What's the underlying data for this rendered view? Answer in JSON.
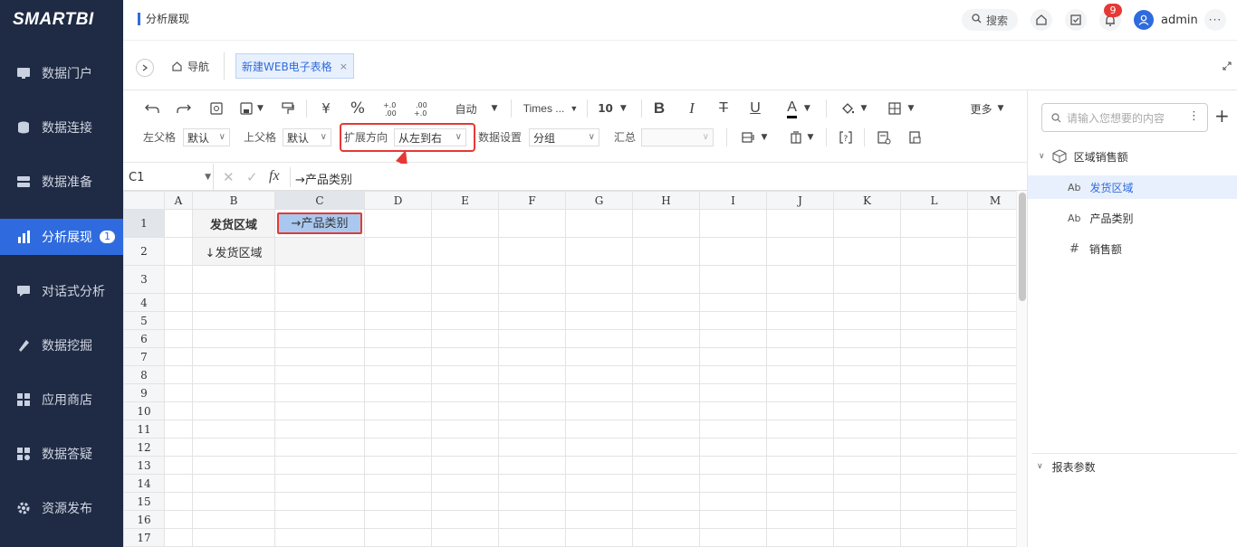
{
  "app": {
    "logo": "SMARTBI",
    "page_title": "分析展现"
  },
  "sidebar": {
    "items": [
      {
        "label": "数据门户",
        "icon": "monitor-icon"
      },
      {
        "label": "数据连接",
        "icon": "database-icon"
      },
      {
        "label": "数据准备",
        "icon": "server-icon"
      },
      {
        "label": "分析展现",
        "icon": "bar-chart-icon",
        "badge": "1",
        "active": true
      },
      {
        "label": "对话式分析",
        "icon": "chat-icon"
      },
      {
        "label": "数据挖掘",
        "icon": "pick-icon"
      },
      {
        "label": "应用商店",
        "icon": "grid-apps-icon"
      },
      {
        "label": "数据答疑",
        "icon": "qa-icon"
      },
      {
        "label": "资源发布",
        "icon": "gear-icon"
      }
    ]
  },
  "topbar": {
    "search_label": "搜索",
    "notification_count": "9",
    "username": "admin"
  },
  "tabs": {
    "nav_label": "导航",
    "active_tab": "新建WEB电子表格"
  },
  "toolbar": {
    "format_auto": "自动",
    "font_name": "Times ...",
    "font_size": "10",
    "more": "更多",
    "yuan": "¥",
    "percent": "%",
    "dec_inc": "⁺.0\n.00",
    "dec_dec": ".00\n⁻.0",
    "left_parent_label": "左父格",
    "left_parent_value": "默认",
    "upper_parent_label": "上父格",
    "upper_parent_value": "默认",
    "expand_dir_label": "扩展方向",
    "expand_dir_value": "从左到右",
    "data_setting_label": "数据设置",
    "data_setting_value": "分组",
    "summary_label": "汇总",
    "summary_value": ""
  },
  "formula": {
    "cell_ref": "C1",
    "fx": "fx",
    "content": "→产品类别"
  },
  "grid": {
    "columns": [
      "A",
      "B",
      "C",
      "D",
      "E",
      "F",
      "G",
      "H",
      "I",
      "J",
      "K",
      "L",
      "M"
    ],
    "rows": [
      "1",
      "2",
      "3",
      "4",
      "5",
      "6",
      "7",
      "8",
      "9",
      "10",
      "11",
      "12",
      "13",
      "14",
      "15",
      "16",
      "17"
    ],
    "cells": {
      "B1": "发货区域",
      "C1": "→产品类别",
      "B2": "↓发货区域"
    }
  },
  "rightpanel": {
    "search_placeholder": "请输入您想要的内容",
    "dataset": "区域销售额",
    "fields": [
      {
        "type": "Ab",
        "label": "发货区域",
        "selected": true
      },
      {
        "type": "Ab",
        "label": "产品类别",
        "selected": false
      },
      {
        "type": "#",
        "label": "销售额",
        "selected": false
      }
    ],
    "report_params": "报表参数"
  },
  "colors": {
    "sidebar_bg": "#1f2a44",
    "accent": "#2f6bde",
    "highlight_red": "#e53935",
    "cell_fill": "#a9c8ef"
  }
}
